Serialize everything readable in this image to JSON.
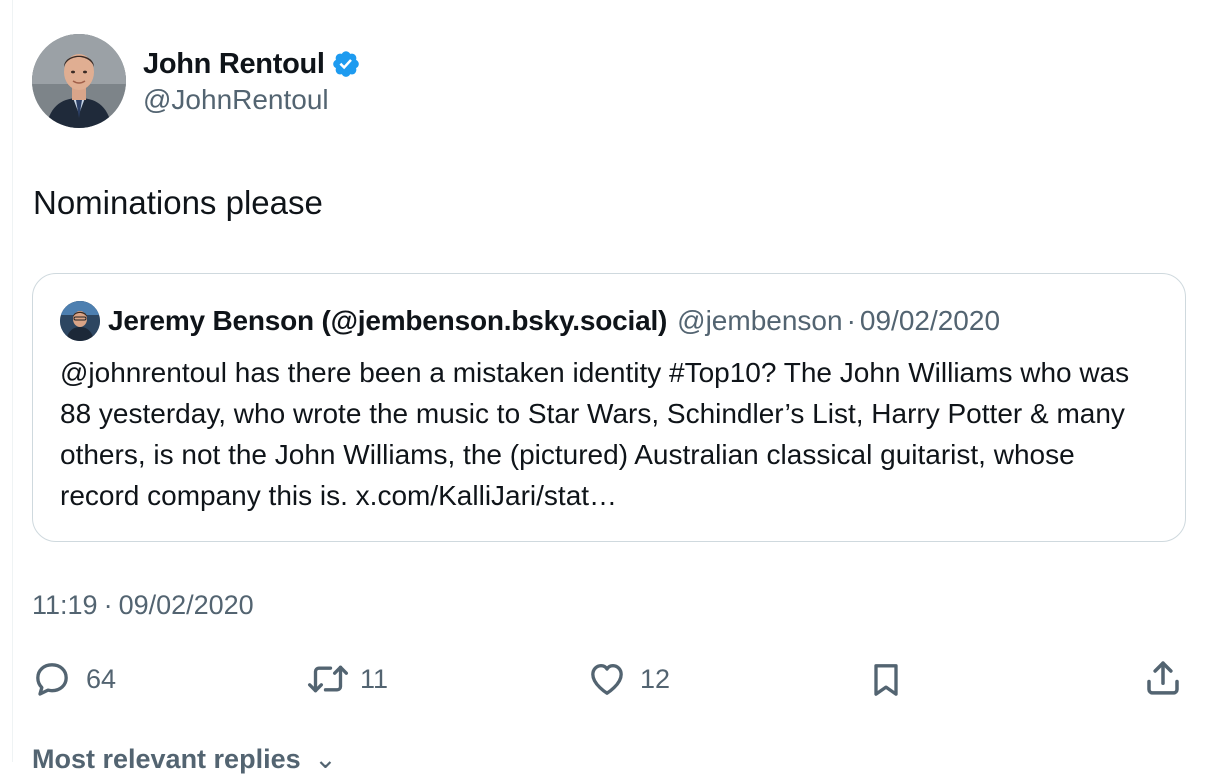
{
  "author": {
    "display_name": "John Rentoul",
    "handle": "@JohnRentoul",
    "verified_icon": "verified-badge-icon",
    "badge_color": "#1d9bf0"
  },
  "tweet": {
    "text": "Nominations please"
  },
  "quote": {
    "display_name": "Jeremy Benson (@jembenson.bsky.social)",
    "handle": "@jembenson",
    "separator": "·",
    "date": "09/02/2020",
    "text": "@johnrentoul has there been a mistaken identity #Top10? The John Williams who was 88 yesterday, who wrote the music to Star Wars, Schindler’s List, Harry Potter & many others, is not the John Williams, the (pictured) Australian classical guitarist, whose record company this is. x.com/KalliJari/stat…"
  },
  "meta": {
    "time": "11:19",
    "separator": "·",
    "date": "09/02/2020"
  },
  "actions": {
    "reply": {
      "icon": "reply-icon",
      "count": "64"
    },
    "retweet": {
      "icon": "retweet-icon",
      "count": "11"
    },
    "like": {
      "icon": "like-icon",
      "count": "12"
    },
    "bookmark": {
      "icon": "bookmark-icon"
    },
    "share": {
      "icon": "share-icon"
    }
  },
  "replies_sort": {
    "label": "Most relevant replies"
  },
  "colors": {
    "text": "#0f1419",
    "secondary": "#536471",
    "border": "#cfd9de",
    "accent": "#1d9bf0"
  }
}
